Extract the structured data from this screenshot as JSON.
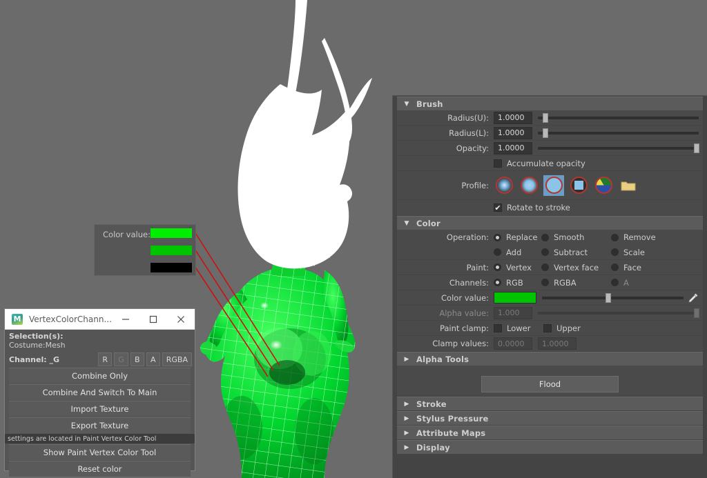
{
  "viewport": {
    "background_color": "#6b6b6b",
    "model_hair_color": "#ffffff",
    "model_body_color": "#00c72b",
    "model_wire_color": "#b4ffc0",
    "annotation_line_color": "#cc1111"
  },
  "callout": {
    "label": "Color value:",
    "swatches": [
      {
        "name": "bright-green",
        "color": "#00ee00"
      },
      {
        "name": "mid-green",
        "color": "#00c400"
      },
      {
        "name": "black",
        "color": "#000000"
      }
    ]
  },
  "dialog": {
    "icon_name": "maya-icon",
    "icon_letter": "M",
    "title": "VertexColorChann...",
    "minimize_label": "—",
    "maximize_label": "□",
    "close_label": "✕",
    "selection_label": "Selection(s):",
    "selection_value": "Costume:Mesh",
    "channel_label": "Channel: _G",
    "channel_buttons": [
      {
        "label": "R",
        "enabled": true
      },
      {
        "label": "G",
        "enabled": false
      },
      {
        "label": "B",
        "enabled": true
      },
      {
        "label": "A",
        "enabled": true
      },
      {
        "label": "RGBA",
        "enabled": true
      }
    ],
    "actions": [
      "Combine Only",
      "Combine And Switch To Main",
      "Import Texture",
      "Export Texture"
    ],
    "note": "settings are located in Paint Vertex Color Tool",
    "actions2": [
      "Show Paint Vertex Color Tool",
      "Reset color"
    ]
  },
  "toolpanel": {
    "brush": {
      "title": "Brush",
      "expanded": true,
      "radius_u_label": "Radius(U):",
      "radius_u_value": "1.0000",
      "radius_u_pct": 3,
      "radius_l_label": "Radius(L):",
      "radius_l_value": "1.0000",
      "radius_l_pct": 3,
      "opacity_label": "Opacity:",
      "opacity_value": "1.0000",
      "opacity_pct": 98,
      "accumulate_label": "Accumulate opacity",
      "accumulate_checked": false,
      "profile_label": "Profile:",
      "profiles": [
        {
          "name": "soft-falloff-brush",
          "kind": "gradient-soft",
          "selected": false
        },
        {
          "name": "medium-falloff-brush",
          "kind": "gradient-medium",
          "selected": false
        },
        {
          "name": "hard-circle-brush",
          "kind": "solid-circle",
          "selected": true
        },
        {
          "name": "square-brush",
          "kind": "solid-square",
          "selected": false
        },
        {
          "name": "image-brush",
          "kind": "image",
          "selected": false
        },
        {
          "name": "browse-folder",
          "kind": "folder",
          "selected": false
        }
      ],
      "rotate_label": "Rotate to stroke",
      "rotate_checked": true
    },
    "color": {
      "title": "Color",
      "expanded": true,
      "operation_label": "Operation:",
      "operations": [
        {
          "label": "Replace",
          "selected": true
        },
        {
          "label": "Smooth",
          "selected": false
        },
        {
          "label": "Remove",
          "selected": false
        },
        {
          "label": "Add",
          "selected": false
        },
        {
          "label": "Subtract",
          "selected": false
        },
        {
          "label": "Scale",
          "selected": false
        }
      ],
      "paint_label": "Paint:",
      "paint_options": [
        {
          "label": "Vertex",
          "selected": true
        },
        {
          "label": "Vertex face",
          "selected": false
        },
        {
          "label": "Face",
          "selected": false
        }
      ],
      "channels_label": "Channels:",
      "channel_options": [
        {
          "label": "RGB",
          "selected": true,
          "enabled": true
        },
        {
          "label": "RGBA",
          "selected": false,
          "enabled": true
        },
        {
          "label": "A",
          "selected": false,
          "enabled": false
        }
      ],
      "color_value_label": "Color value:",
      "color_value_hex": "#00c400",
      "color_value_pct": 45,
      "eyedropper_name": "eyedropper-icon",
      "alpha_value_label": "Alpha value:",
      "alpha_value": "1.000",
      "alpha_pct": 98,
      "paint_clamp_label": "Paint clamp:",
      "clamp_lower_label": "Lower",
      "clamp_lower_checked": false,
      "clamp_upper_label": "Upper",
      "clamp_upper_checked": false,
      "clamp_values_label": "Clamp values:",
      "clamp_min": "0.0000",
      "clamp_max": "1.0000"
    },
    "alpha_tools": {
      "title": "Alpha Tools",
      "expanded": false
    },
    "flood_label": "Flood",
    "collapsed_sections": [
      {
        "title": "Stroke"
      },
      {
        "title": "Stylus Pressure"
      },
      {
        "title": "Attribute Maps"
      },
      {
        "title": "Display"
      }
    ]
  }
}
